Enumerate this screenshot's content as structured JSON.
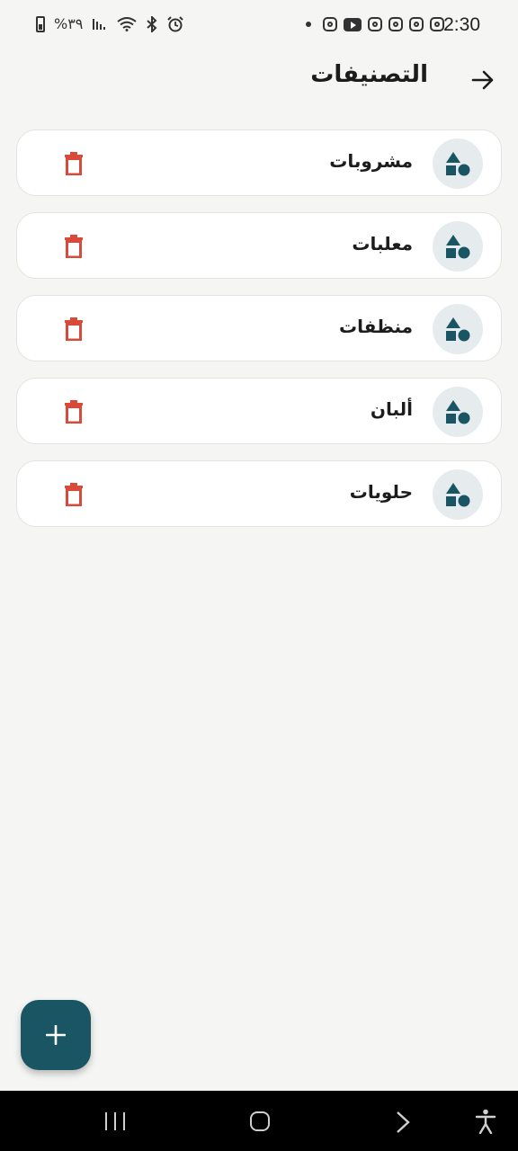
{
  "status_bar": {
    "time": "2:30",
    "battery": "%٣٩",
    "icons": [
      "alarm-icon",
      "bluetooth-icon",
      "wifi-icon",
      "signal-icon",
      "instagram-icon",
      "youtube-icon"
    ]
  },
  "header": {
    "title": "التصنيفات",
    "back_icon": "arrow-right-icon"
  },
  "categories": [
    {
      "name": "مشروبات"
    },
    {
      "name": "معلبات"
    },
    {
      "name": "منظفات"
    },
    {
      "name": "ألبان"
    },
    {
      "name": "حلويات"
    }
  ],
  "colors": {
    "accent": "#1a5563",
    "delete": "#d84a3a",
    "background": "#f5f5f3",
    "avatar_bg": "#e6ecee"
  },
  "fab": {
    "icon": "plus-icon"
  }
}
